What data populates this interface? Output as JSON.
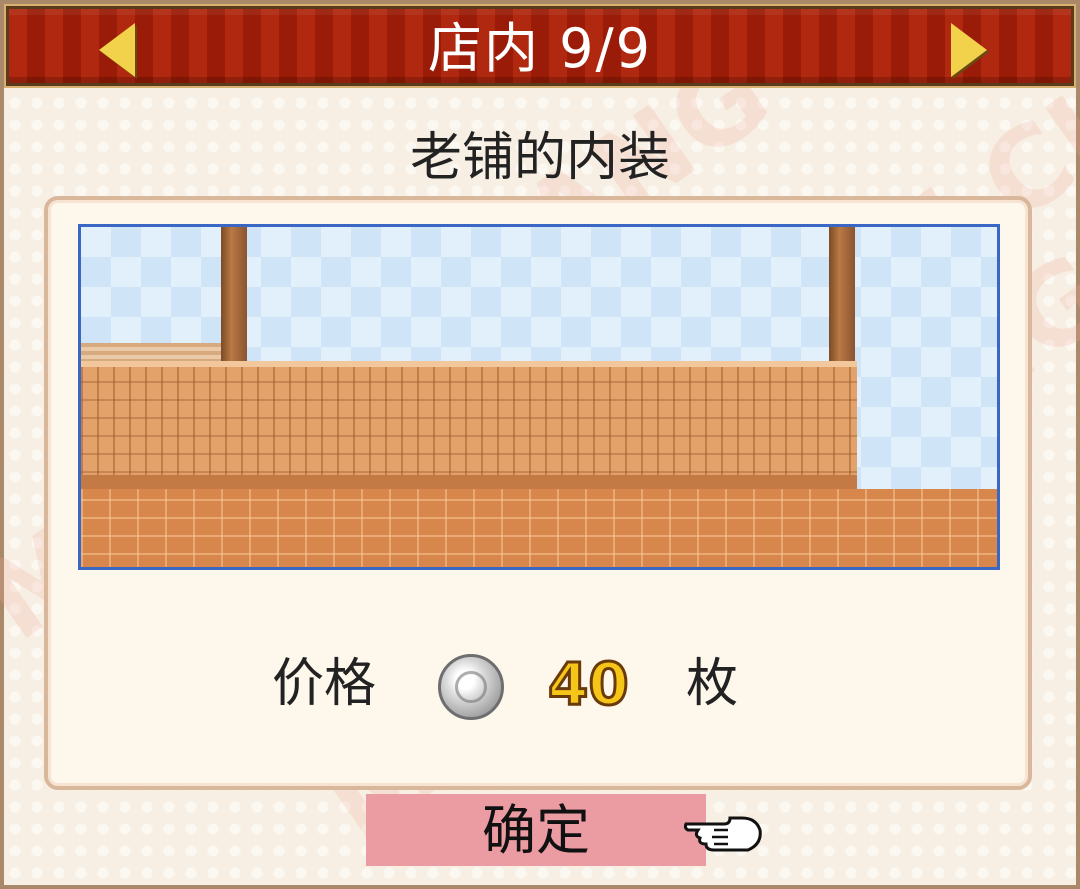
{
  "header": {
    "title": "店内 9/9",
    "prev_icon": "arrow-left-icon",
    "next_icon": "arrow-right-icon"
  },
  "item": {
    "name": "老铺的内装"
  },
  "price": {
    "label": "价格",
    "coin_icon": "silver-coin-icon",
    "value": "40",
    "unit": "枚"
  },
  "confirm": {
    "label": "确定",
    "pointer_icon": "pointing-hand-icon"
  },
  "watermark": {
    "text": "MO GEI CHANG"
  },
  "colors": {
    "title_bar": "#a8220c",
    "confirm_bg": "#eb9ba2",
    "preview_border": "#3a66c4",
    "price_gold": "#f5c518"
  }
}
